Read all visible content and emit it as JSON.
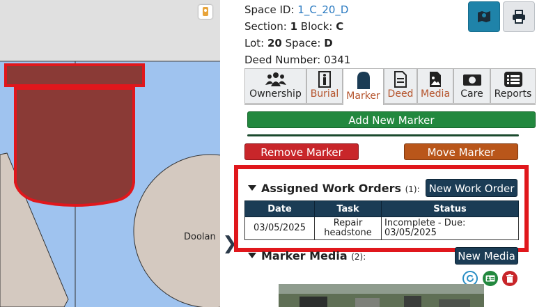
{
  "map": {
    "plot_label": "Doolan"
  },
  "info": {
    "space_id_label": "Space ID:",
    "space_id_value": "1_C_20_D",
    "section_label": "Section:",
    "section_value": "1",
    "block_label": "Block:",
    "block_value": "C",
    "lot_label": "Lot:",
    "lot_value": "20",
    "space_label": "Space:",
    "space_value": "D",
    "deed_label": "Deed Number: 0341"
  },
  "toolbar": {
    "map_icon": "map-icon",
    "print_icon": "printer-icon"
  },
  "tabs": [
    {
      "label": "Ownership",
      "icon": "people-icon"
    },
    {
      "label": "Burial",
      "icon": "person-standing-icon"
    },
    {
      "label": "Marker",
      "icon": "headstone-icon"
    },
    {
      "label": "Deed",
      "icon": "document-icon"
    },
    {
      "label": "Media",
      "icon": "image-file-icon"
    },
    {
      "label": "Care",
      "icon": "money-icon"
    },
    {
      "label": "Reports",
      "icon": "list-icon"
    }
  ],
  "marker": {
    "add_label": "Add New Marker",
    "remove_label": "Remove Marker",
    "move_label": "Move Marker"
  },
  "work_orders": {
    "title": "Assigned Work Orders",
    "count": "(1):",
    "new_label": "New Work Order",
    "columns": [
      "Date",
      "Task",
      "Status"
    ],
    "rows": [
      {
        "date": "03/05/2025",
        "task": "Repair headstone",
        "status": "Incomplete - Due: 03/05/2025"
      }
    ]
  },
  "media": {
    "title": "Marker Media",
    "count": "(2):",
    "new_label": "New Media"
  },
  "colors": {
    "map_water": "#9fc3ef",
    "plot_fill": "#8a3a36",
    "highlight_red": "#e0171c",
    "green": "#22883e",
    "orange": "#b9561a",
    "navy": "#1b3c55"
  }
}
